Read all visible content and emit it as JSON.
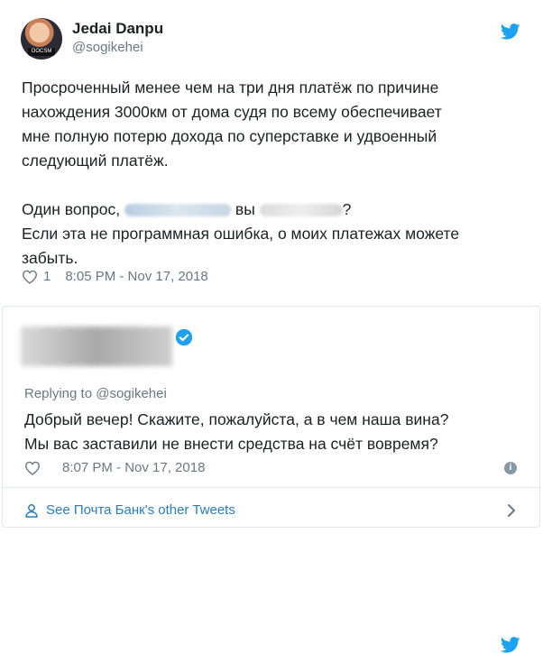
{
  "tweet1": {
    "author_name": "Jedai Danpu",
    "author_handle": "@sogikehei",
    "avatar_badge": "OOCSM",
    "lines": [
      "Просроченный менее чем на три дня платёж по причине",
      "нахождения 3000км от дома судя по всему обеспечивает",
      "мне полную потерю дохода по суперставке и удвоенный",
      "следующий платёж."
    ],
    "question_prefix": "Один вопрос,",
    "question_middle": "вы",
    "question_suffix": "?",
    "last_lines": [
      "Если эта не программная ошибка, о моих платежах можете",
      "забыть."
    ],
    "likes": "1",
    "timestamp": "8:05 PM - Nov 17, 2018"
  },
  "tweet2": {
    "replying_to": "Replying to @sogikehei",
    "lines": [
      "Добрый вечер! Скажите, пожалуйста, а в чем наша вина?",
      "Мы вас заставили не внести средства на счёт вовремя?"
    ],
    "timestamp": "8:07 PM - Nov 17, 2018",
    "info_label": "i"
  },
  "footer": {
    "see_more": "See Почта Банк's other Tweets"
  },
  "colors": {
    "brand_blue": "#1da1f2",
    "link_blue": "#2b7bb9",
    "muted_gray": "#697882",
    "text": "#1c2022",
    "border": "#e1e8ed"
  },
  "icons": [
    "twitter-bird-icon",
    "heart-icon",
    "verified-badge-icon",
    "info-icon",
    "person-icon",
    "chevron-right-icon"
  ]
}
